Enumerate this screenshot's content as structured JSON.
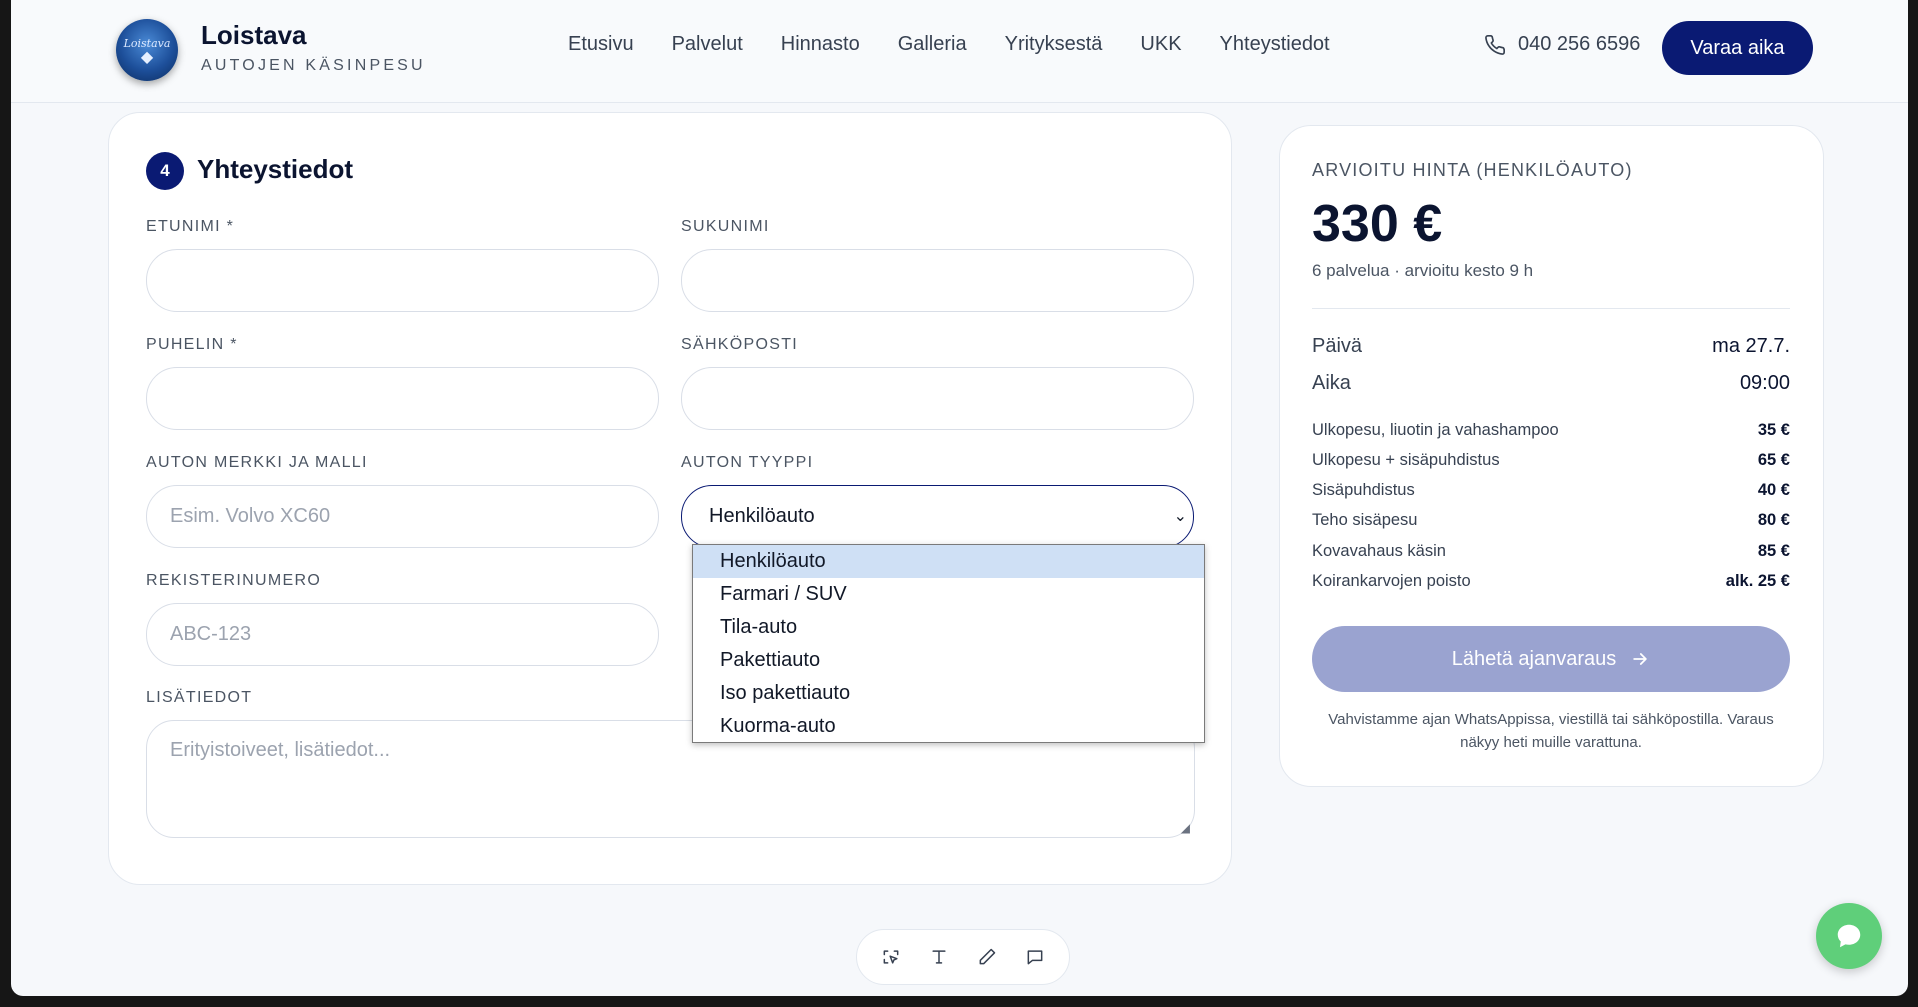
{
  "header": {
    "brand_name": "Loistava",
    "brand_sub": "AUTOJEN KÄSINPESU",
    "logo_text": "Loistava",
    "nav": [
      "Etusivu",
      "Palvelut",
      "Hinnasto",
      "Galleria",
      "Yrityksestä",
      "UKK",
      "Yhteystiedot"
    ],
    "phone": "040 256 6596",
    "cta": "Varaa aika"
  },
  "form": {
    "step_number": "4",
    "title": "Yhteystiedot",
    "labels": {
      "first_name": "ETUNIMI *",
      "last_name": "SUKUNIMI",
      "phone": "PUHELIN *",
      "email": "SÄHKÖPOSTI",
      "car_model": "AUTON MERKKI JA MALLI",
      "car_type": "AUTON TYYPPI",
      "plate": "REKISTERINUMERO",
      "notes": "LISÄTIEDOT"
    },
    "placeholders": {
      "car_model": "Esim. Volvo XC60",
      "plate": "ABC-123",
      "notes": "Erityistoiveet, lisätiedot..."
    },
    "car_type_selected": "Henkilöauto",
    "car_type_options": [
      "Henkilöauto",
      "Farmari / SUV",
      "Tila-auto",
      "Pakettiauto",
      "Iso pakettiauto",
      "Kuorma-auto"
    ]
  },
  "summary": {
    "heading": "ARVIOITU HINTA (HENKILÖAUTO)",
    "price": "330 €",
    "meta": "6 palvelua · arvioitu kesto 9 h",
    "date_label": "Päivä",
    "date_value": "ma 27.7.",
    "time_label": "Aika",
    "time_value": "09:00",
    "services": [
      {
        "name": "Ulkopesu, liuotin ja vahashampoo",
        "price": "35 €"
      },
      {
        "name": "Ulkopesu + sisäpuhdistus",
        "price": "65 €"
      },
      {
        "name": "Sisäpuhdistus",
        "price": "40 €"
      },
      {
        "name": "Teho sisäpesu",
        "price": "80 €"
      },
      {
        "name": "Kovavahaus käsin",
        "price": "85 €"
      },
      {
        "name": "Koirankarvojen poisto",
        "price": "alk. 25 €"
      }
    ],
    "send_button": "Lähetä ajanvaraus",
    "note": "Vahvistamme ajan WhatsAppissa, viestillä tai sähköpostilla. Varaus näkyy heti muille varattuna."
  },
  "icons": {
    "phone": "phone-icon",
    "arrow": "arrow-right-icon",
    "toolbar": [
      "select-area-icon",
      "text-icon",
      "pencil-icon",
      "comment-icon"
    ],
    "chat": "chat-bubble-icon"
  },
  "colors": {
    "brand": "#0a1a73",
    "send_disabled": "#9aa3d0",
    "chat": "#5fcf7a"
  }
}
